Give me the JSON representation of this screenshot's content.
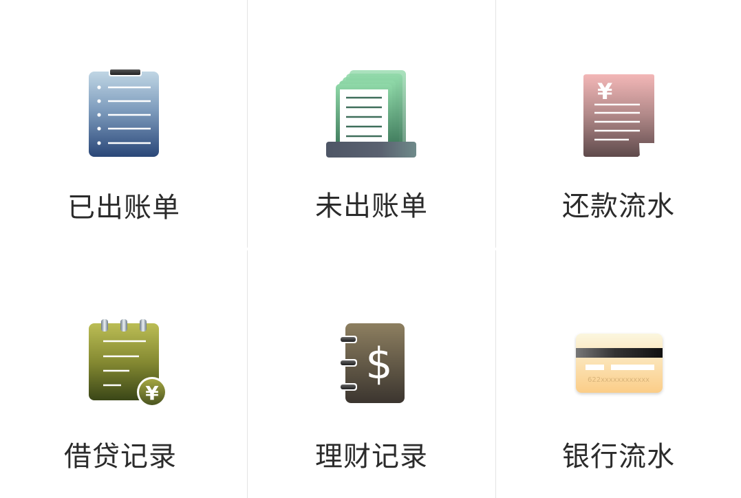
{
  "menu": {
    "items": [
      {
        "label": "已出账单",
        "icon": "clipboard-list-icon"
      },
      {
        "label": "未出账单",
        "icon": "bill-stack-icon"
      },
      {
        "label": "还款流水",
        "icon": "yuan-receipt-icon"
      },
      {
        "label": "借贷记录",
        "icon": "notepad-yuan-icon"
      },
      {
        "label": "理财记录",
        "icon": "dollar-notebook-icon"
      },
      {
        "label": "银行流水",
        "icon": "bank-card-icon"
      }
    ],
    "card_number": "622xxxxxxxxxxxx",
    "receipt_symbol": "¥",
    "badge_symbol": "¥",
    "notebook_symbol": "$"
  },
  "colors": {
    "clipboard": [
      "#b8cfe0",
      "#2a4a80"
    ],
    "stack": [
      "#7fcf9a",
      "#4a7a62"
    ],
    "receipt": [
      "#f2b6b6",
      "#6a4f50"
    ],
    "notepad": [
      "#b4b84e",
      "#3e4a1c"
    ],
    "notebook": [
      "#8a7c5e",
      "#3d3730"
    ],
    "card": [
      "#faf3d8",
      "#fbcf8c"
    ]
  }
}
